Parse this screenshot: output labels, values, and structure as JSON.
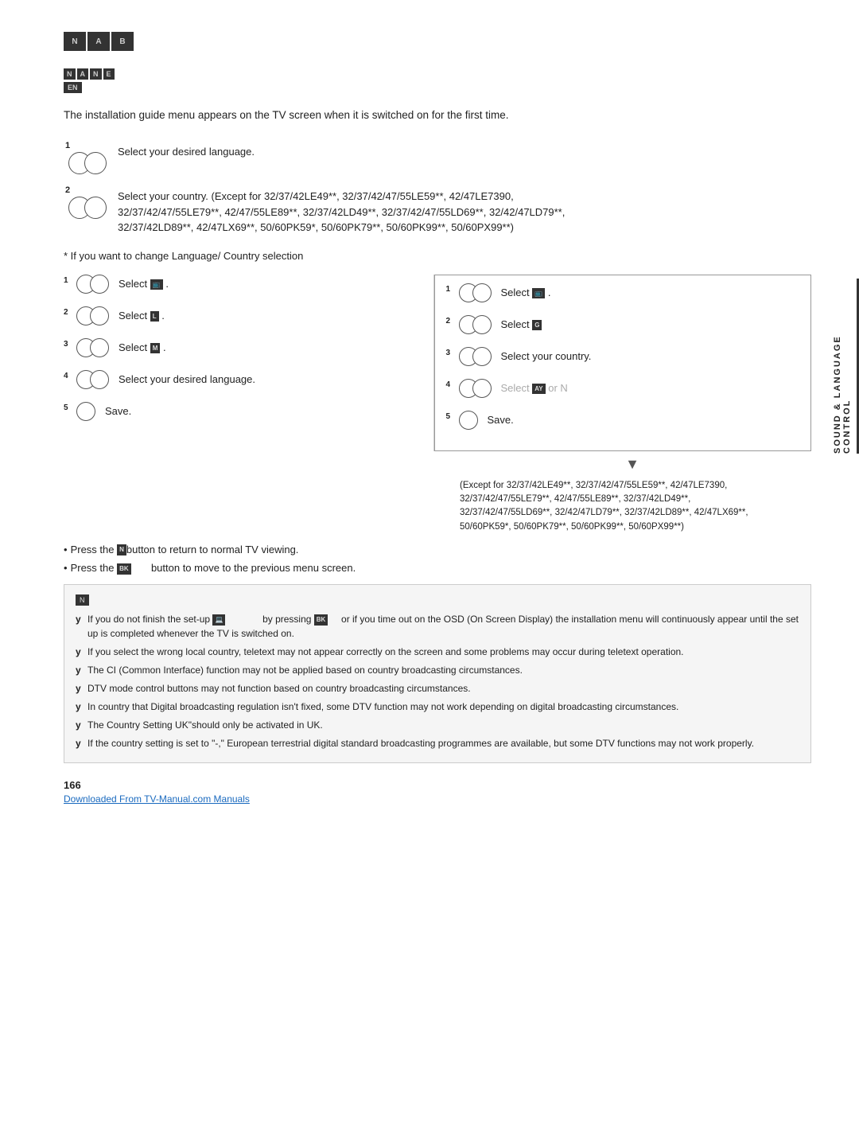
{
  "logo": {
    "cells": [
      "N",
      "A",
      "B"
    ],
    "label": "NAB Logo"
  },
  "sub_logo": {
    "cells": [
      "N",
      "A",
      "N",
      "E"
    ],
    "note_cell": "EN"
  },
  "intro_text": "The installation guide menu appears on the TV screen when it is switched on for the first time.",
  "initial_steps": [
    {
      "num": "1",
      "text": "Select your desired language."
    },
    {
      "num": "2",
      "text": "Select your country. (Except for 32/37/42LE49**, 32/37/42/47/55LE59**, 42/47LE7390,\n32/37/42/47/55LE79**, 42/47/55LE89**, 32/37/42LD49**, 32/37/42/47/55LD69**, 32/42/47LD79**,\n32/37/42LD89**, 42/47LX69**, 50/60PK59*, 50/60PK79**, 50/60PK99**, 50/60PX99**)"
    }
  ],
  "change_note": "* If you want to change Language/ Country selection",
  "left_col_steps": [
    {
      "num": "1",
      "text": "Select",
      "icon": "MENU",
      "suffix": "."
    },
    {
      "num": "2",
      "text": "Select",
      "icon": "L",
      "suffix": "."
    },
    {
      "num": "3",
      "text": "Select",
      "icon": "M",
      "suffix": "."
    },
    {
      "num": "4",
      "text": "Select your desired language.",
      "icon": "",
      "suffix": ""
    },
    {
      "num": "5",
      "text": "Save.",
      "icon": "",
      "suffix": ""
    }
  ],
  "right_col_steps": [
    {
      "num": "1",
      "text": "Select",
      "icon": "MENU",
      "suffix": "."
    },
    {
      "num": "2",
      "text": "Select",
      "icon": "G",
      "suffix": ""
    },
    {
      "num": "3",
      "text": "Select your country.",
      "icon": "",
      "suffix": ""
    },
    {
      "num": "4",
      "text": "Select",
      "icon": "AY",
      "suffix": " or N",
      "grayed": true
    },
    {
      "num": "5",
      "text": "Save.",
      "icon": "",
      "suffix": ""
    }
  ],
  "except_note": "(Except for 32/37/42LE49**, 32/37/42/47/55LE59**, 42/47LE7390,\n32/37/42/47/55LE79**, 42/47/55LE89**, 32/37/42LD49**,\n32/37/42/47/55LD69**, 32/42/47LD79**, 32/37/42LD89**, 42/47LX69**,\n50/60PK59*, 50/60PK79**, 50/60PK99**, 50/60PX99**)",
  "bullets": [
    {
      "text": "Press the",
      "icon": "N",
      "suffix": "button to return to normal TV viewing."
    },
    {
      "text": "Press the",
      "icon": "BK",
      "suffix": "     button to move to the previous menu screen."
    }
  ],
  "note_title": "N",
  "note_items": [
    "If you do not finish the set-up [icon] by pressing BK     or if you time out on the OSD (On Screen Display) the installation menu will continuously appear until the set up is completed whenever the TV is switched on.",
    "If you select the wrong local country, teletext may not appear correctly on the screen and some problems may occur during teletext operation.",
    "The CI (Common Interface) function may not be applied based on country broadcasting circumstances.",
    "DTV mode control buttons may not function based on country broadcasting circumstances.",
    "In country that Digital broadcasting regulation isn't fixed, some DTV function may not work depending on digital broadcasting circumstances.",
    "The Country Setting UK\"should only be activated in UK.",
    "If the country setting is set to \"-,\" European terrestrial digital standard broadcasting programmes are available, but some DTV functions may not work properly."
  ],
  "page_number": "166",
  "footer_link": "Downloaded From TV-Manual.com Manuals",
  "sidebar_text": "SOUND & LANGUAGE CONTROL"
}
